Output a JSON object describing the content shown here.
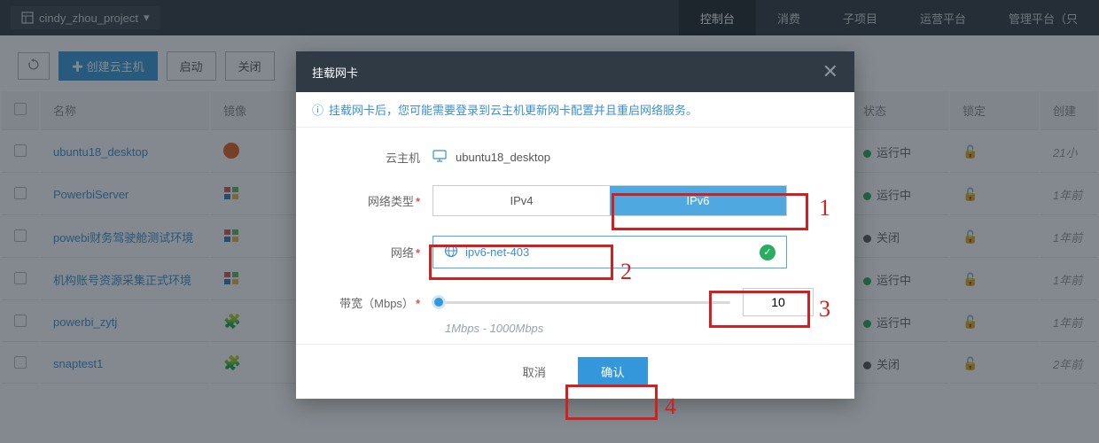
{
  "header": {
    "project": "cindy_zhou_project",
    "nav": [
      "控制台",
      "消费",
      "子项目",
      "运营平台",
      "管理平台（只"
    ]
  },
  "toolbar": {
    "create": "创建云主机",
    "start": "启动",
    "shutdown": "关闭"
  },
  "table": {
    "cols": {
      "name": "名称",
      "image": "镜像",
      "status": "状态",
      "lock": "锁定",
      "created": "创建"
    },
    "rows": [
      {
        "name": "ubuntu18_desktop",
        "img": "ubuntu",
        "status": "运行中",
        "on": true,
        "created": "21小"
      },
      {
        "name": "PowerbiServer",
        "img": "win",
        "status": "运行中",
        "on": true,
        "created": "1年前"
      },
      {
        "name": "powebi财务驾驶舱测试环境",
        "img": "win",
        "status": "关闭",
        "on": false,
        "created": "1年前"
      },
      {
        "name": "机构账号资源采集正式环境",
        "img": "win",
        "status": "运行中",
        "on": true,
        "created": "1年前"
      },
      {
        "name": "powerbi_zytj",
        "img": "puzzle",
        "status": "运行中",
        "on": true,
        "created": "1年前"
      },
      {
        "name": "snaptest1",
        "img": "puzzle",
        "status": "关闭",
        "on": false,
        "created": "2年前"
      }
    ]
  },
  "modal": {
    "title": "挂载网卡",
    "info": "挂载网卡后，您可能需要登录到云主机更新网卡配置并且重启网络服务。",
    "labels": {
      "host": "云主机",
      "nettype": "网络类型",
      "network": "网络",
      "bandwidth": "带宽（Mbps）"
    },
    "host": "ubuntu18_desktop",
    "ipv4": "IPv4",
    "ipv6": "IPv6",
    "network": "ipv6-net-403",
    "bandwidth": "10",
    "bwHint": "1Mbps - 1000Mbps",
    "cancel": "取消",
    "confirm": "确认"
  },
  "anno": {
    "n1": "1",
    "n2": "2",
    "n3": "3",
    "n4": "4"
  }
}
